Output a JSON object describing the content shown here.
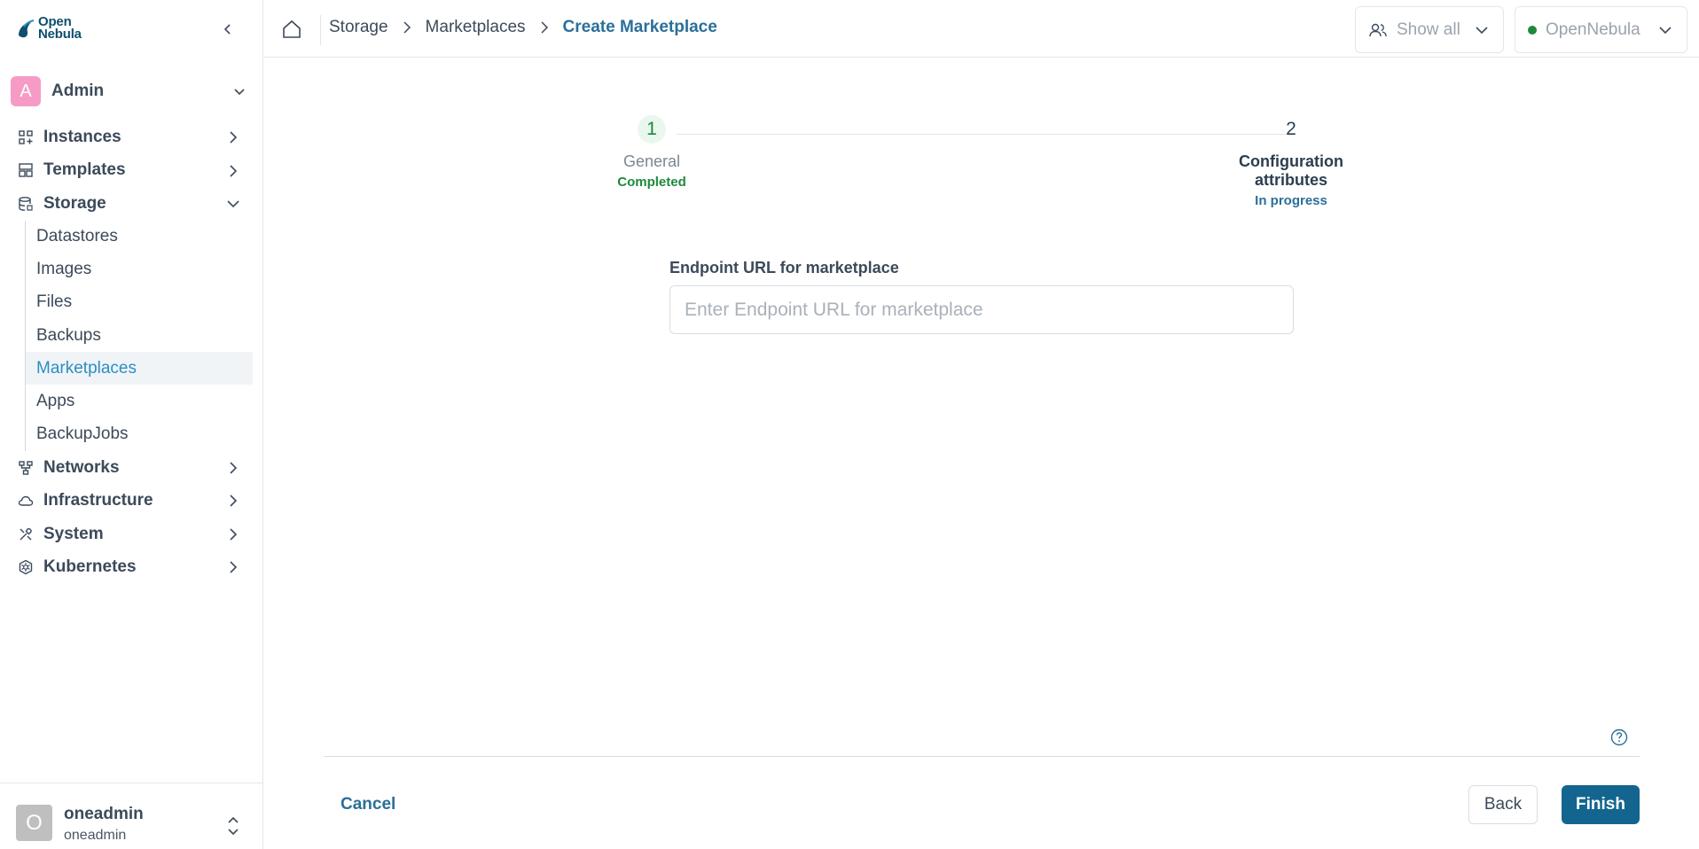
{
  "brand": {
    "line1": "Open",
    "line2": "Nebula",
    "color": "#0e4f6e"
  },
  "sidebar": {
    "group": {
      "avatar_letter": "A",
      "label": "Admin"
    },
    "items": [
      {
        "label": "Instances",
        "icon": "grid-plus-icon"
      },
      {
        "label": "Templates",
        "icon": "layout-icon"
      },
      {
        "label": "Storage",
        "icon": "database-icon",
        "expanded": true
      },
      {
        "label": "Networks",
        "icon": "network-icon"
      },
      {
        "label": "Infrastructure",
        "icon": "cloud-icon"
      },
      {
        "label": "System",
        "icon": "tools-icon"
      },
      {
        "label": "Kubernetes",
        "icon": "kubernetes-icon"
      }
    ],
    "storage_sub": [
      "Datastores",
      "Images",
      "Files",
      "Backups",
      "Marketplaces",
      "Apps",
      "BackupJobs"
    ],
    "active_sub": "Marketplaces",
    "user": {
      "avatar_letter": "O",
      "name": "oneadmin",
      "group": "oneadmin"
    }
  },
  "header": {
    "breadcrumb": [
      "Storage",
      "Marketplaces"
    ],
    "current": "Create Marketplace",
    "filter_label": "Show all",
    "zone_label": "OpenNebula",
    "zone_status_color": "#1c8a3b"
  },
  "stepper": {
    "steps": [
      {
        "number": "1",
        "title": "General",
        "state": "Completed"
      },
      {
        "number": "2",
        "title": "Configuration attributes",
        "state": "In progress"
      }
    ]
  },
  "form": {
    "endpoint_label": "Endpoint URL for marketplace",
    "endpoint_placeholder": "Enter Endpoint URL for marketplace",
    "endpoint_value": ""
  },
  "footer": {
    "cancel": "Cancel",
    "back": "Back",
    "finish": "Finish"
  },
  "colors": {
    "accent": "#2b6f99",
    "primary_button": "#13658f",
    "success": "#1c8a3b"
  }
}
